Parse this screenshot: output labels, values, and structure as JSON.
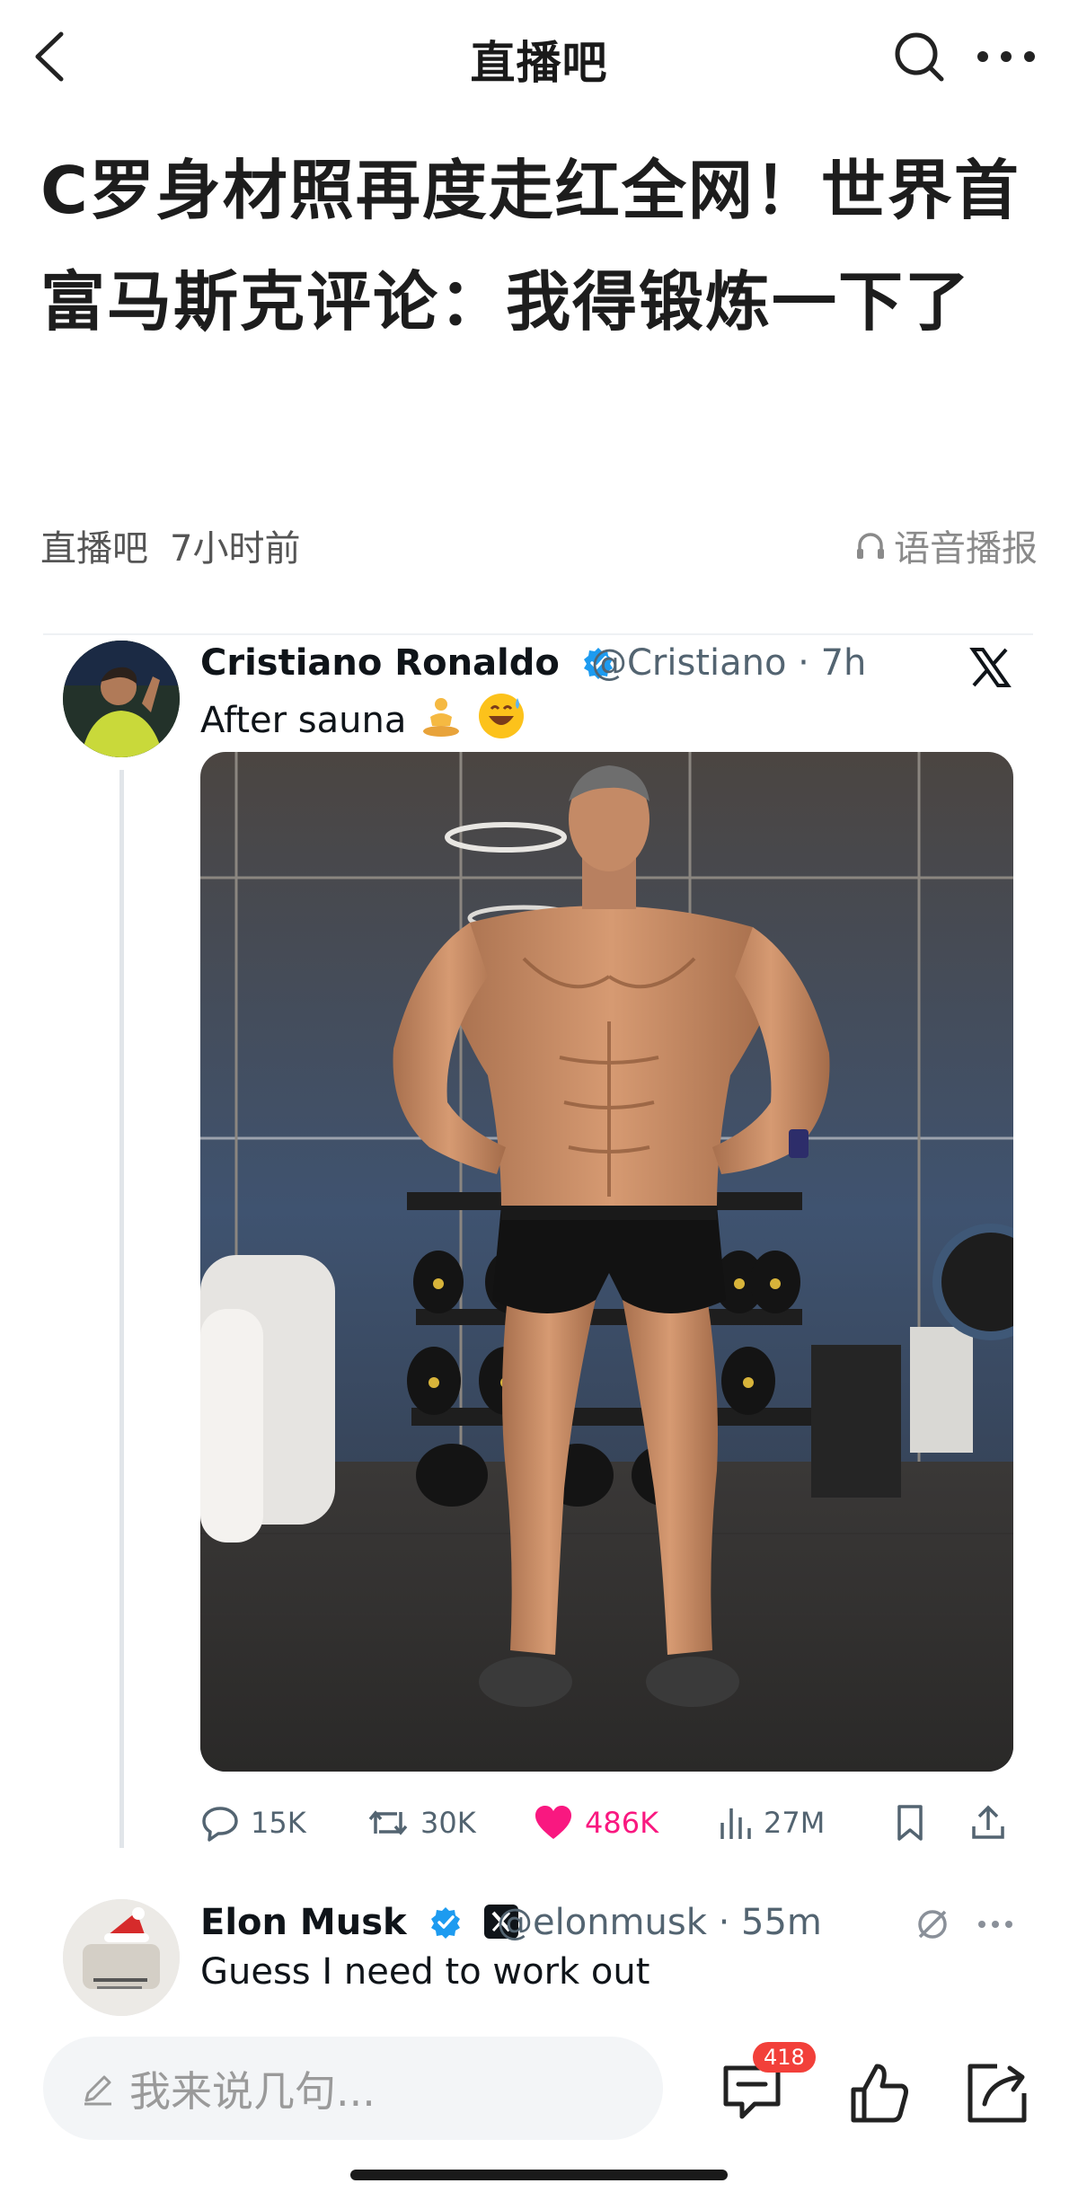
{
  "nav": {
    "title": "直播吧",
    "icons": [
      "chevron-left-icon",
      "search-icon",
      "more-icon"
    ]
  },
  "article": {
    "title": "C罗身材照再度走红全网！世界首富马斯克评论：我得锻炼一下了",
    "source": "直播吧",
    "time": "7小时前",
    "listen_label": "语音播报"
  },
  "tweet": {
    "name": "Cristiano Ronaldo",
    "handle_time": "@Cristiano · 7h",
    "text": "After sauna",
    "emojis": [
      "person-in-lotus-position",
      "grinning-sweat-face"
    ],
    "stats": {
      "replies": "15K",
      "retweets": "30K",
      "likes": "486K",
      "views": "27M"
    },
    "like_color": "#f91880"
  },
  "reply": {
    "name": "Elon Musk",
    "handle_time": "@elonmusk · 55m",
    "text": "Guess I need to work out"
  },
  "bottom": {
    "comment_placeholder": "我来说几句...",
    "comment_count": "418"
  },
  "colors": {
    "verified": "#1d9bf0",
    "badge": "#f2403a"
  }
}
